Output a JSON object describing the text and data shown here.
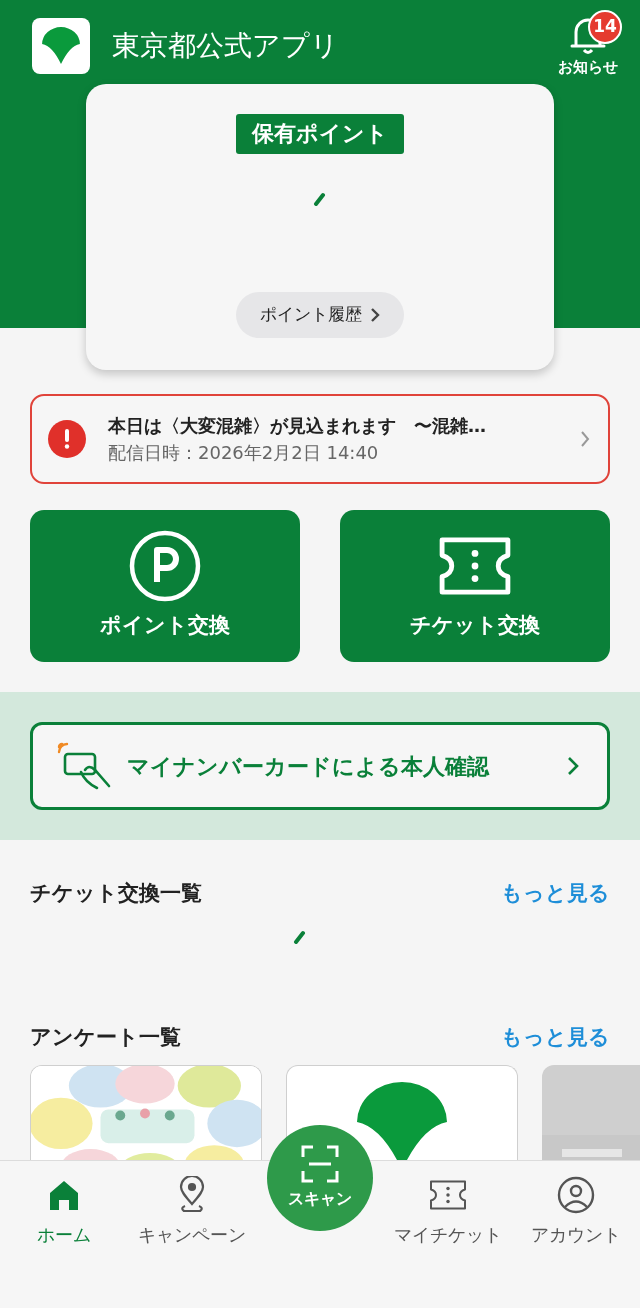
{
  "header": {
    "title": "東京都公式アプリ",
    "notifications": {
      "label": "お知らせ",
      "count": "14"
    }
  },
  "points_card": {
    "title": "保有ポイント",
    "history_button": "ポイント履歴"
  },
  "alert": {
    "title": "本日は〈大変混雑〉が見込まれます　〜混雑…",
    "date": "配信日時：2026年2月2日 14:40"
  },
  "actions": [
    {
      "kind": "points",
      "label": "ポイント交換"
    },
    {
      "kind": "ticket",
      "label": "チケット交換"
    }
  ],
  "identity_button": "マイナンバーカードによる本人確認",
  "sections": [
    {
      "kind": "loading",
      "title": "チケット交換一覧",
      "more": "もっと見る"
    },
    {
      "kind": "cards",
      "title": "アンケート一覧",
      "more": "もっと見る"
    }
  ],
  "survey_cards": [
    {
      "kind": "picture"
    },
    {
      "kind": "logo"
    },
    {
      "kind": "picture"
    }
  ],
  "nav": [
    {
      "kind": "home",
      "label": "ホーム",
      "selected": true
    },
    {
      "kind": "campaign",
      "label": "キャンペーン",
      "selected": false
    },
    {
      "kind": "scan",
      "label": "スキャン",
      "selected": false
    },
    {
      "kind": "ticket",
      "label": "マイチケット",
      "selected": false
    },
    {
      "kind": "account",
      "label": "アカウント",
      "selected": false
    }
  ]
}
